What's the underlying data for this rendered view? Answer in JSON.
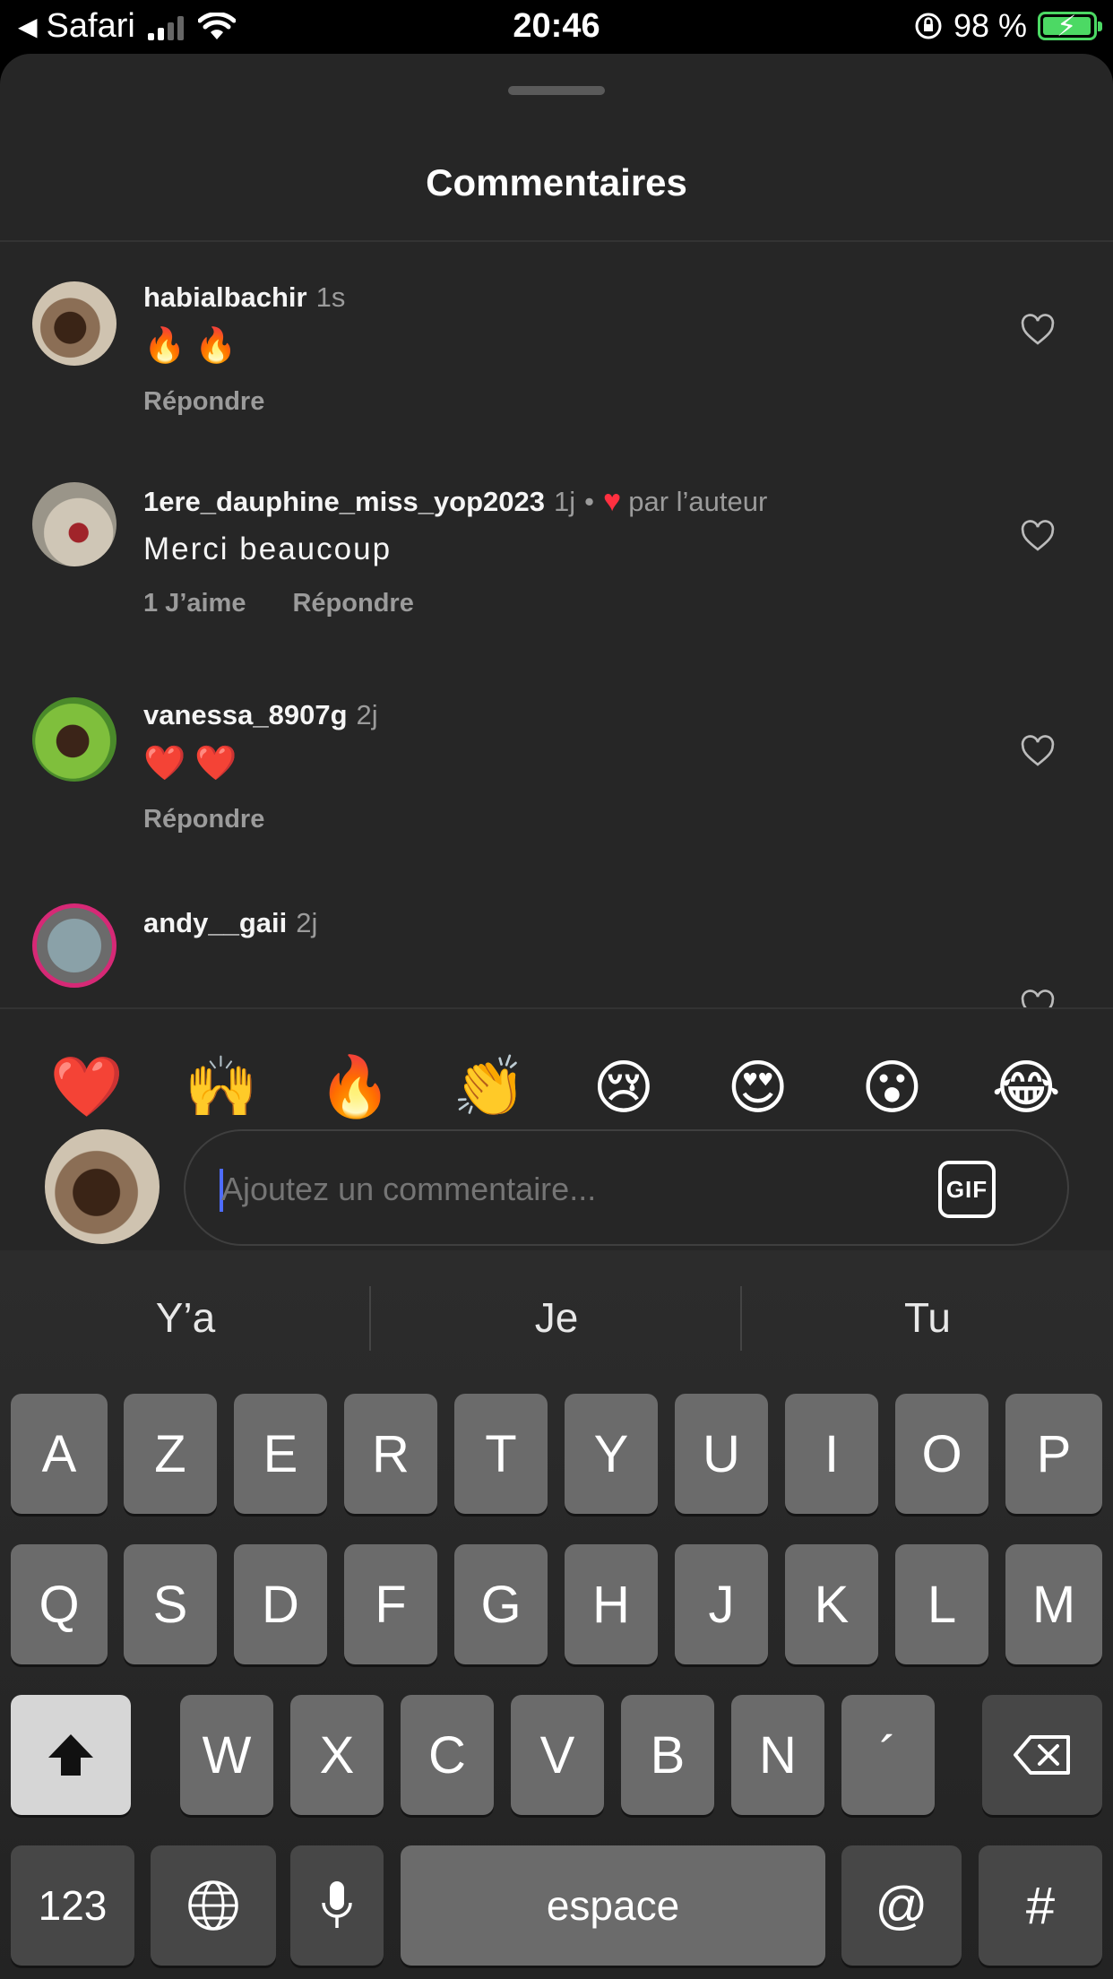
{
  "status_bar": {
    "back_app": "Safari",
    "time": "20:46",
    "battery": "98 %"
  },
  "sheet": {
    "title": "Commentaires"
  },
  "comments": [
    {
      "user": "habialbachir",
      "time": "1s",
      "text": "🔥🔥",
      "actions": [
        "Répondre"
      ]
    },
    {
      "user": "1ere_dauphine_miss_yop2023",
      "time": "1j",
      "liked_by_author": "par l’auteur",
      "text": "Merci beaucoup",
      "actions": [
        "1 J’aime",
        "Répondre"
      ]
    },
    {
      "user": "vanessa_8907g",
      "time": "2j",
      "text": "❤️❤️",
      "actions": [
        "Répondre"
      ]
    },
    {
      "user": "andy__gaii",
      "time": "2j"
    }
  ],
  "emoji_bar": [
    "❤️",
    "🙌",
    "🔥",
    "👏",
    "😢",
    "😍",
    "😮",
    "😂"
  ],
  "composer": {
    "placeholder": "Ajoutez un commentaire...",
    "gif_label": "GIF"
  },
  "keyboard": {
    "suggestions": [
      "Y’a",
      "Je",
      "Tu"
    ],
    "row1": [
      "A",
      "Z",
      "E",
      "R",
      "T",
      "Y",
      "U",
      "I",
      "O",
      "P"
    ],
    "row2": [
      "Q",
      "S",
      "D",
      "F",
      "G",
      "H",
      "J",
      "K",
      "L",
      "M"
    ],
    "row3": [
      "W",
      "X",
      "C",
      "V",
      "B",
      "N",
      "´"
    ],
    "numbers_key": "123",
    "space_key": "espace",
    "at_key": "@",
    "hash_key": "#"
  }
}
